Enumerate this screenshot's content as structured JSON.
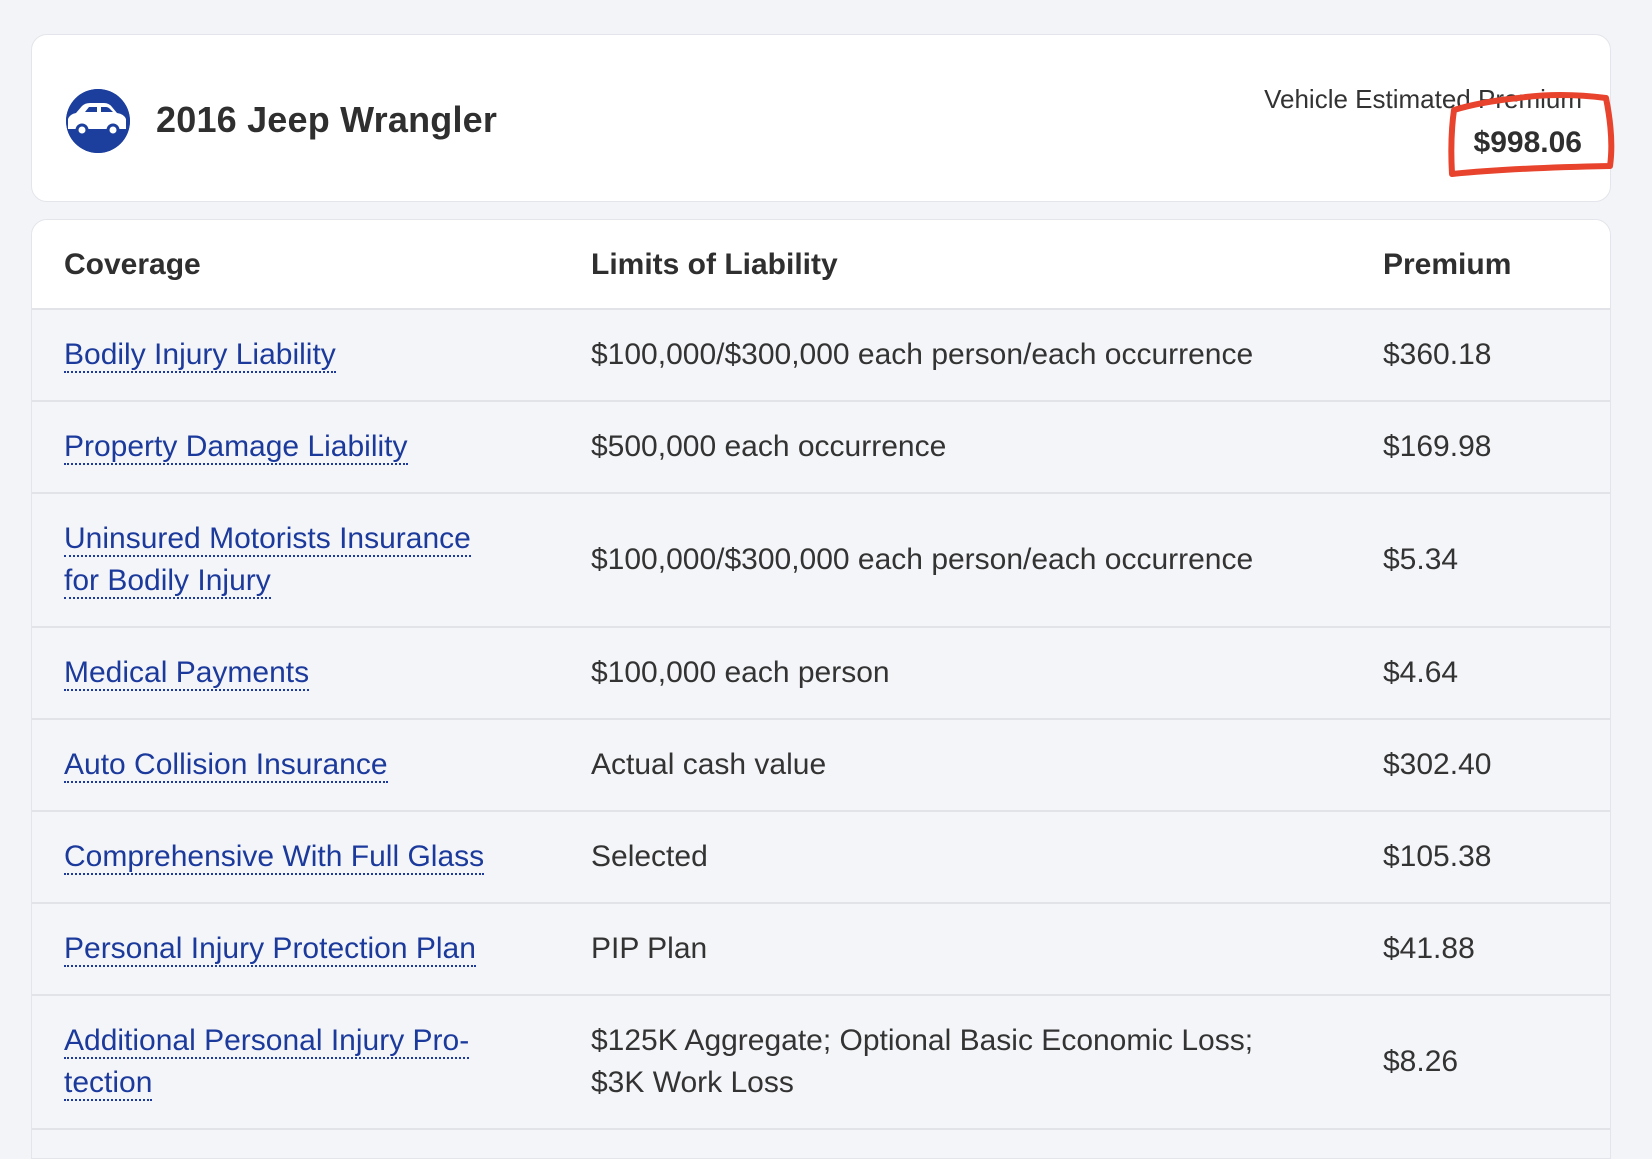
{
  "vehicle": {
    "name": "2016 Jeep Wrangler",
    "icon": "car-icon",
    "premium_label": "Vehicle Estimated Premium",
    "premium_value": "$998.06",
    "highlight_color": "#e8432c"
  },
  "table": {
    "headers": {
      "coverage": "Coverage",
      "limits": "Limits of Liability",
      "premium": "Premium"
    },
    "rows": [
      {
        "coverage": "Bodily Injury Liability",
        "limits": "$100,000/$300,000 each person/each occurrence",
        "premium": "$360.18"
      },
      {
        "coverage": "Property Damage Liability",
        "limits": "$500,000 each occurrence",
        "premium": "$169.98"
      },
      {
        "coverage": "Uninsured Motorists Insurance for Bodily Injury",
        "limits": "$100,000/$300,000 each person/each occurrence",
        "premium": "$5.34"
      },
      {
        "coverage": "Medical Payments",
        "limits": "$100,000 each person",
        "premium": "$4.64"
      },
      {
        "coverage": "Auto Collision Insurance",
        "limits": "Actual cash value",
        "premium": "$302.40"
      },
      {
        "coverage": "Comprehensive With Full Glass",
        "limits": "Selected",
        "premium": "$105.38"
      },
      {
        "coverage": "Personal Injury Protection Plan",
        "limits": "PIP Plan",
        "premium": "$41.88"
      },
      {
        "coverage": "Additional Personal Injury Pro-tection",
        "limits": "$125K Aggregate; Optional Basic Economic Loss; $3K Work Loss",
        "premium": "$8.26"
      }
    ]
  },
  "colors": {
    "link": "#1b3a9c",
    "icon_bg": "#1c3f9e",
    "background": "#f3f4f8"
  }
}
